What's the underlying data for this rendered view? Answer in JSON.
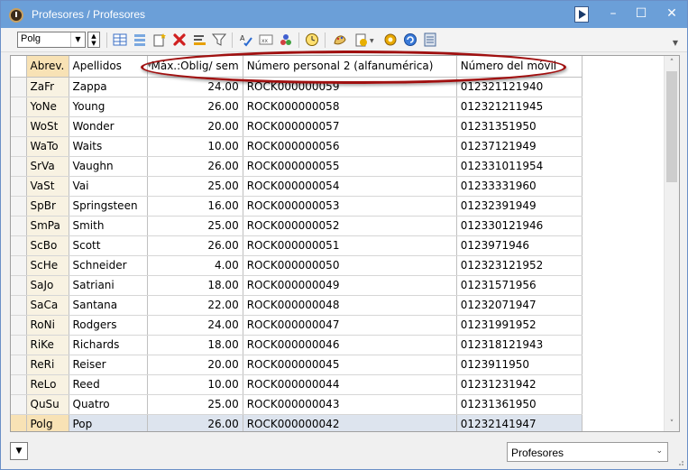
{
  "window": {
    "title": "Profesores / Profesores"
  },
  "toolbar": {
    "selector_value": "Polg",
    "icons": [
      "new-row-icon",
      "list-icon",
      "new-record-icon",
      "delete-icon",
      "sort-icon",
      "filter-icon",
      "spellcheck-icon",
      "field-icon",
      "group-icon",
      "clock-icon",
      "settings-icon",
      "document-settings-icon",
      "gear-icon",
      "refresh-icon",
      "report-icon"
    ]
  },
  "table": {
    "columns": [
      "Abrev.",
      "Apellidos",
      "Máx.:Oblig/ sem",
      "Número personal 2 (alfanumérica)",
      "Número del móvil"
    ],
    "rows": [
      [
        "ZaFr",
        "Zappa",
        "24.00",
        "ROCK000000059",
        "012321121940"
      ],
      [
        "YoNe",
        "Young",
        "26.00",
        "ROCK000000058",
        "012321211945"
      ],
      [
        "WoSt",
        "Wonder",
        "20.00",
        "ROCK000000057",
        "01231351950"
      ],
      [
        "WaTo",
        "Waits",
        "10.00",
        "ROCK000000056",
        "01237121949"
      ],
      [
        "SrVa",
        "Vaughn",
        "26.00",
        "ROCK000000055",
        "012331011954"
      ],
      [
        "VaSt",
        "Vai",
        "25.00",
        "ROCK000000054",
        "01233331960"
      ],
      [
        "SpBr",
        "Springsteen",
        "16.00",
        "ROCK000000053",
        "01232391949"
      ],
      [
        "SmPa",
        "Smith",
        "25.00",
        "ROCK000000052",
        "012330121946"
      ],
      [
        "ScBo",
        "Scott",
        "26.00",
        "ROCK000000051",
        "0123971946"
      ],
      [
        "ScHe",
        "Schneider",
        "4.00",
        "ROCK000000050",
        "012323121952"
      ],
      [
        "SaJo",
        "Satriani",
        "18.00",
        "ROCK000000049",
        "01231571956"
      ],
      [
        "SaCa",
        "Santana",
        "22.00",
        "ROCK000000048",
        "01232071947"
      ],
      [
        "RoNi",
        "Rodgers",
        "24.00",
        "ROCK000000047",
        "01231991952"
      ],
      [
        "RiKe",
        "Richards",
        "18.00",
        "ROCK000000046",
        "012318121943"
      ],
      [
        "ReRi",
        "Reiser",
        "20.00",
        "ROCK000000045",
        "0123911950"
      ],
      [
        "ReLo",
        "Reed",
        "10.00",
        "ROCK000000044",
        "01231231942"
      ],
      [
        "QuSu",
        "Quatro",
        "25.00",
        "ROCK000000043",
        "01231361950"
      ],
      [
        "Polg",
        "Pop",
        "26.00",
        "ROCK000000042",
        "01232141947"
      ]
    ],
    "active_row": "Polg"
  },
  "footer": {
    "view_select": "Profesores"
  },
  "colors": {
    "titlebar": "#6b9fd8",
    "highlight": "#a01010",
    "abbr_header": "#f8e2b5"
  }
}
